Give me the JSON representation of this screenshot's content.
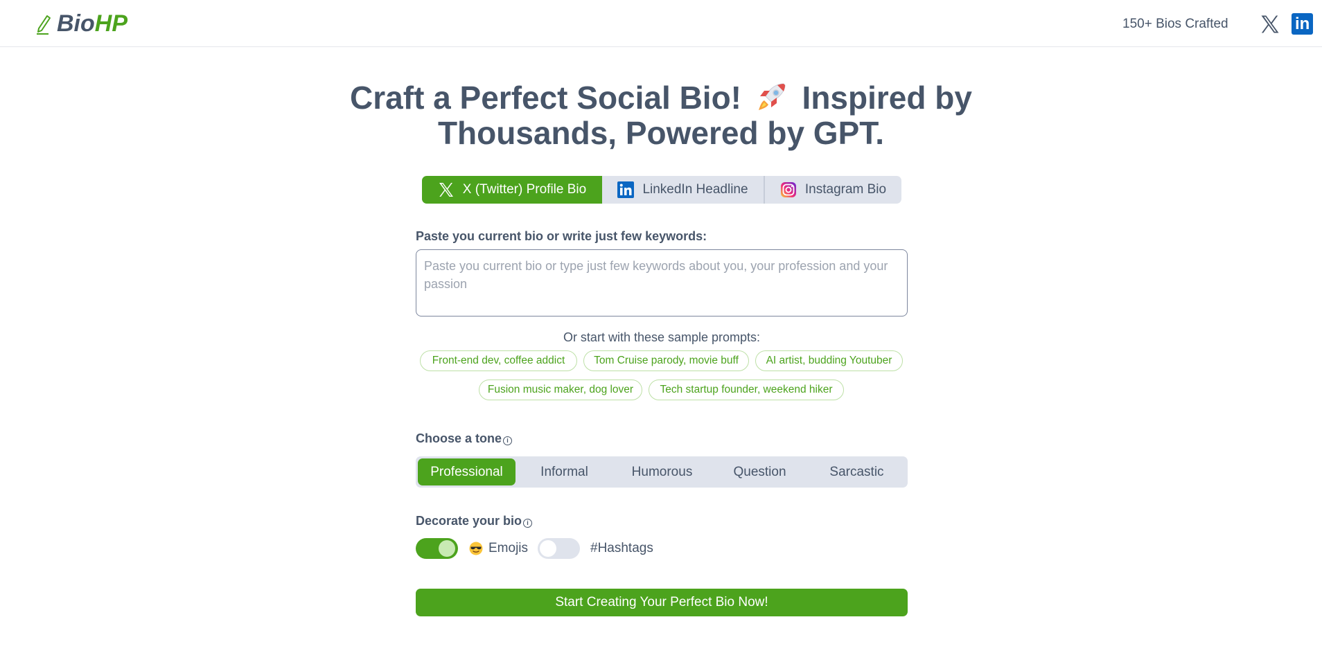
{
  "header": {
    "logo_part1": "Bio",
    "logo_part2": "HP",
    "crafted_count": "150+ Bios Crafted",
    "social_links": [
      {
        "icon": "x-icon"
      },
      {
        "icon": "linkedin-icon"
      }
    ]
  },
  "hero": {
    "title_line1_a": "Craft a Perfect Social Bio!",
    "title_line1_b": "Inspired by",
    "title_line2": "Thousands, Powered by GPT.",
    "emoji": "rocket-icon"
  },
  "platform_tabs": [
    {
      "label": "X (Twitter) Profile Bio",
      "icon": "x-icon",
      "active": true
    },
    {
      "label": "LinkedIn Headline",
      "icon": "linkedin-icon",
      "active": false
    },
    {
      "label": "Instagram Bio",
      "icon": "instagram-icon",
      "active": false
    }
  ],
  "bio_input": {
    "label": "Paste you current bio or write just few keywords:",
    "value": "",
    "placeholder": "Paste you current bio or type just few keywords about you, your profession and your passion"
  },
  "samples": {
    "heading": "Or start with these sample prompts:",
    "prompts": [
      "Front-end dev, coffee addict",
      "Tom Cruise parody, movie buff",
      "AI artist, budding Youtuber",
      "Fusion music maker, dog lover",
      "Tech startup founder, weekend hiker"
    ]
  },
  "tone": {
    "label": "Choose a tone",
    "info_glyph": "i",
    "options": [
      "Professional",
      "Informal",
      "Humorous",
      "Question",
      "Sarcastic"
    ],
    "selected": "Professional"
  },
  "decorate": {
    "label": "Decorate your bio",
    "info_glyph": "i",
    "emojis": {
      "label": "Emojis",
      "icon": "sunglasses-face-icon",
      "enabled": true
    },
    "hashtags": {
      "label": "#Hashtags",
      "enabled": false
    }
  },
  "cta": {
    "label": "Start Creating Your Perfect Bio Now!"
  },
  "colors": {
    "brand_green": "#4ca31d",
    "text_slate": "#475569",
    "segment_bg": "#dfe3ec",
    "chip_border": "#bde0a6"
  }
}
